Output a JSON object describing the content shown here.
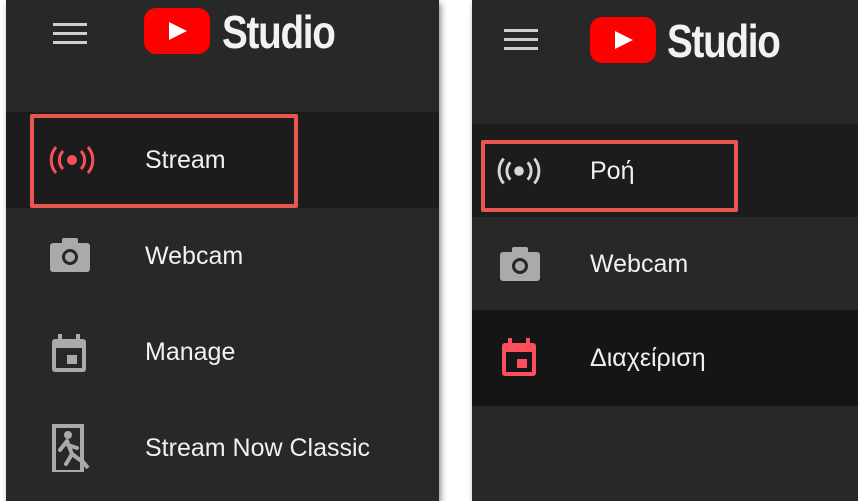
{
  "app": {
    "logo_text": "Studio"
  },
  "left_panel": {
    "items": [
      {
        "label": "Stream",
        "icon": "live-broadcast-icon",
        "selected": true,
        "highlighted": true
      },
      {
        "label": "Webcam",
        "icon": "camera-icon"
      },
      {
        "label": "Manage",
        "icon": "calendar-icon"
      },
      {
        "label": "Stream Now Classic",
        "icon": "exit-run-icon"
      }
    ]
  },
  "right_panel": {
    "items": [
      {
        "label": "Ροή",
        "icon": "live-broadcast-icon",
        "selected": true,
        "highlighted": true
      },
      {
        "label": "Webcam",
        "icon": "camera-icon"
      },
      {
        "label": "Διαχείριση",
        "icon": "calendar-icon",
        "active": true
      }
    ]
  },
  "colors": {
    "panel_bg": "#282828",
    "selected_bg": "#1c1c1c",
    "highlight_border": "#e8574f",
    "brand_red": "#ff0000",
    "icon_gray": "#aaaaaa",
    "accent_red": "#ff4e5b"
  }
}
